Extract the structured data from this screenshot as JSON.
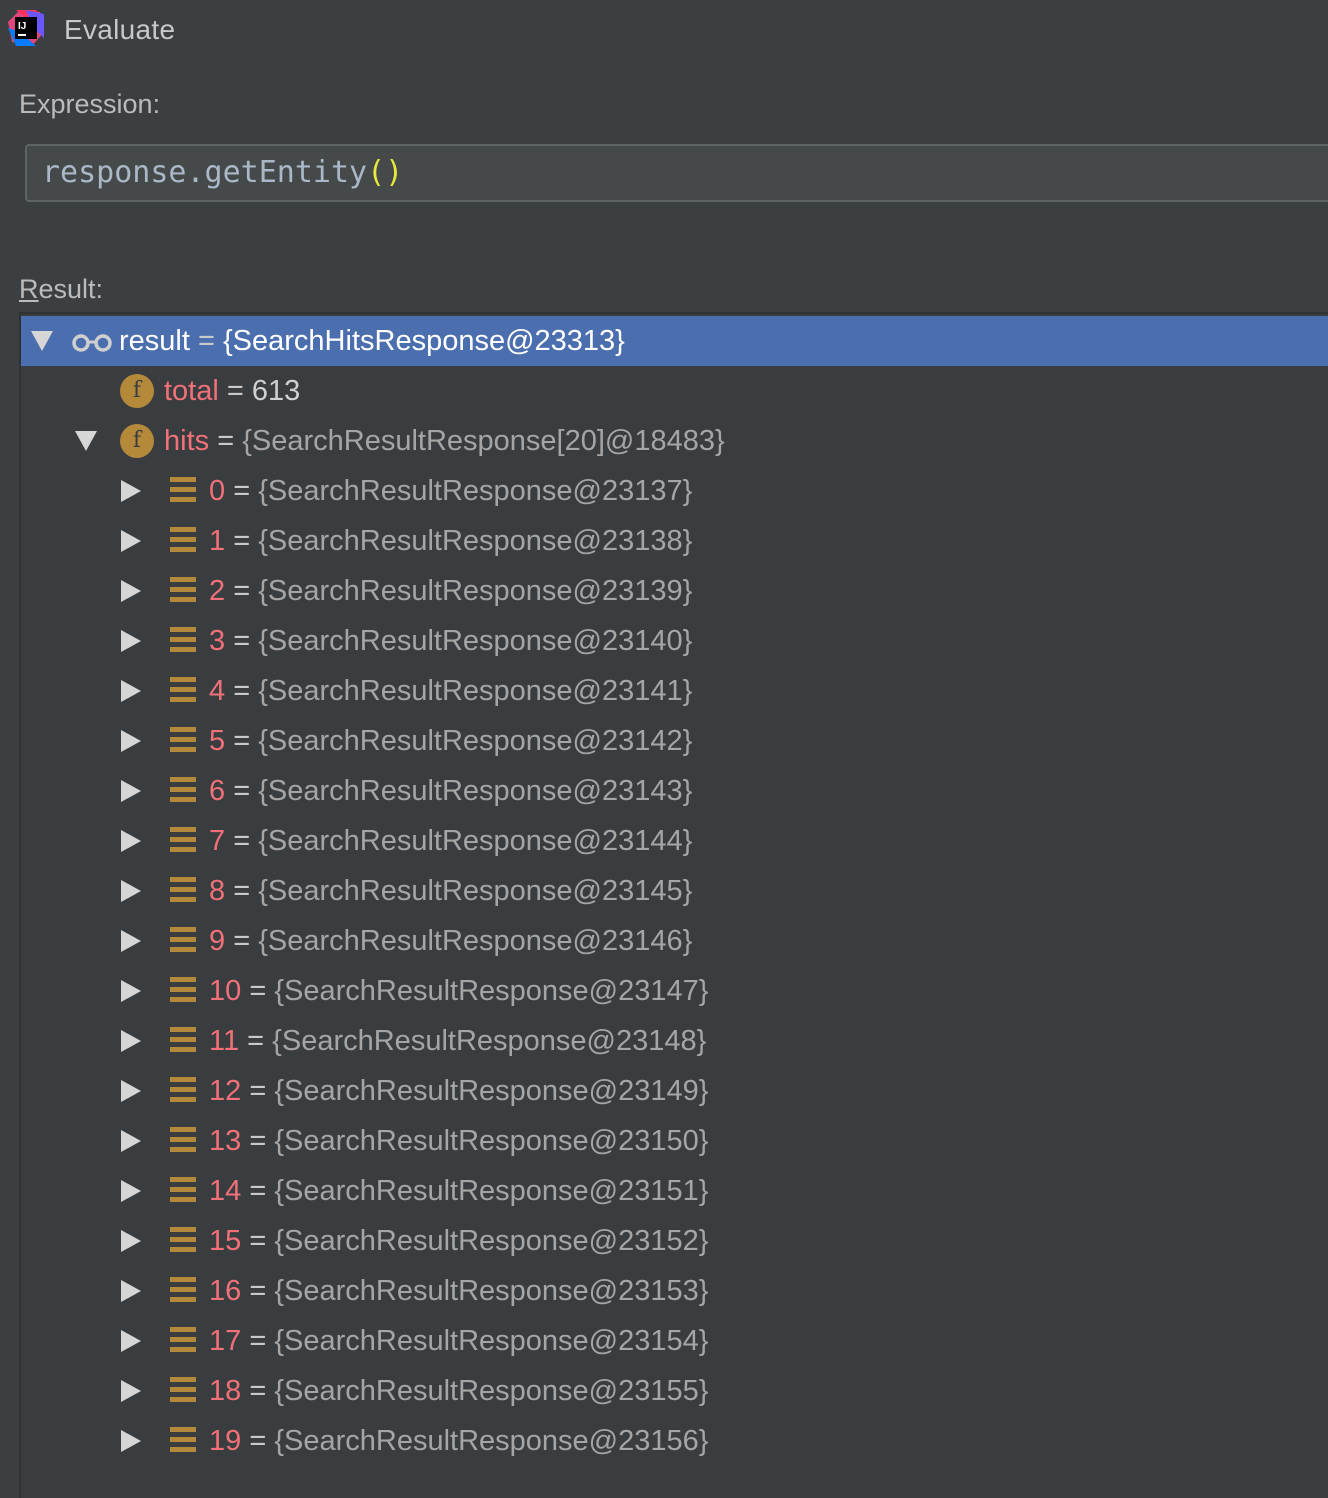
{
  "window": {
    "title": "Evaluate",
    "app_icon": "intellij-idea-icon"
  },
  "expression": {
    "label": "Expression:",
    "value_main": "response.getEntity",
    "value_parens": "()"
  },
  "result": {
    "label_underlined": "R",
    "label_rest": "esult:",
    "root": {
      "name": "result",
      "eq": "=",
      "value": "{SearchHitsResponse@23313}",
      "icon": "watch-glasses-icon"
    },
    "fields": [
      {
        "name": "total",
        "eq": "=",
        "value": "613",
        "icon": "field-icon"
      },
      {
        "name": "hits",
        "eq": "=",
        "value": "{SearchResultResponse[20]@18483}",
        "icon": "field-icon"
      }
    ],
    "hits": [
      {
        "index": "0",
        "eq": "=",
        "value": "{SearchResultResponse@23137}"
      },
      {
        "index": "1",
        "eq": "=",
        "value": "{SearchResultResponse@23138}"
      },
      {
        "index": "2",
        "eq": "=",
        "value": "{SearchResultResponse@23139}"
      },
      {
        "index": "3",
        "eq": "=",
        "value": "{SearchResultResponse@23140}"
      },
      {
        "index": "4",
        "eq": "=",
        "value": "{SearchResultResponse@23141}"
      },
      {
        "index": "5",
        "eq": "=",
        "value": "{SearchResultResponse@23142}"
      },
      {
        "index": "6",
        "eq": "=",
        "value": "{SearchResultResponse@23143}"
      },
      {
        "index": "7",
        "eq": "=",
        "value": "{SearchResultResponse@23144}"
      },
      {
        "index": "8",
        "eq": "=",
        "value": "{SearchResultResponse@23145}"
      },
      {
        "index": "9",
        "eq": "=",
        "value": "{SearchResultResponse@23146}"
      },
      {
        "index": "10",
        "eq": "=",
        "value": "{SearchResultResponse@23147}"
      },
      {
        "index": "11",
        "eq": "=",
        "value": "{SearchResultResponse@23148}"
      },
      {
        "index": "12",
        "eq": "=",
        "value": "{SearchResultResponse@23149}"
      },
      {
        "index": "13",
        "eq": "=",
        "value": "{SearchResultResponse@23150}"
      },
      {
        "index": "14",
        "eq": "=",
        "value": "{SearchResultResponse@23151}"
      },
      {
        "index": "15",
        "eq": "=",
        "value": "{SearchResultResponse@23152}"
      },
      {
        "index": "16",
        "eq": "=",
        "value": "{SearchResultResponse@23153}"
      },
      {
        "index": "17",
        "eq": "=",
        "value": "{SearchResultResponse@23154}"
      },
      {
        "index": "18",
        "eq": "=",
        "value": "{SearchResultResponse@23155}"
      },
      {
        "index": "19",
        "eq": "=",
        "value": "{SearchResultResponse@23156}"
      }
    ]
  },
  "colors": {
    "background": "#3c3f41",
    "selection": "#4b6eaf",
    "field_name": "#f07178",
    "icon_gold": "#b5893a",
    "paren_highlight": "#e8e83a"
  }
}
